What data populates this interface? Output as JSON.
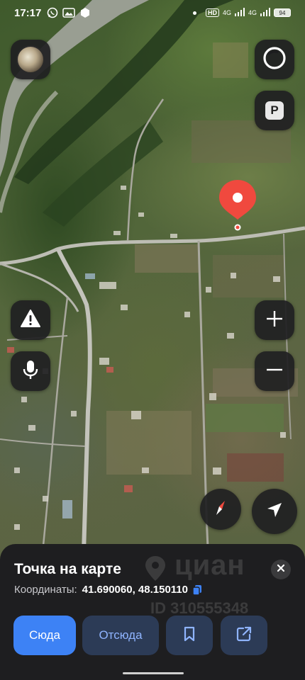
{
  "status_bar": {
    "time": "17:17",
    "hd_label": "HD",
    "network_1": "4G",
    "network_2": "4G",
    "battery": "94"
  },
  "map": {
    "type": "satellite",
    "pin_color": "#f0493e",
    "icons": [
      "profile-avatar",
      "alice-assistant",
      "parking",
      "warning",
      "microphone",
      "zoom-in",
      "zoom-out",
      "compass",
      "my-location"
    ]
  },
  "sheet": {
    "title": "Точка на карте",
    "coords_label": "Координаты:",
    "coords_value": "41.690060, 48.150110",
    "buttons": {
      "to_here": "Сюда",
      "from_here": "Отсюда"
    },
    "watermark": {
      "brand": "циан",
      "id_text": "ID 310555348"
    }
  },
  "colors": {
    "accent": "#3d82f5",
    "secondary_button_bg": "#2c3b56",
    "secondary_button_text": "#8fb4ff",
    "sheet_bg": "#1e1e20"
  }
}
